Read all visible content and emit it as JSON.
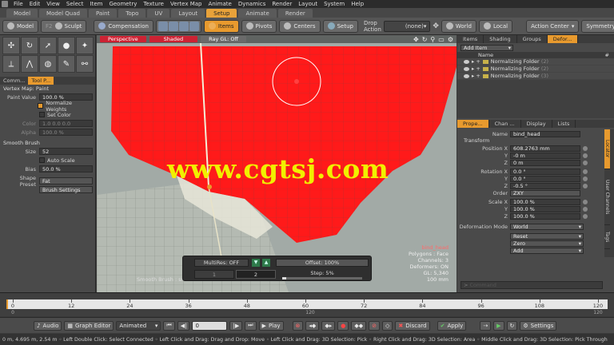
{
  "menu": [
    "File",
    "Edit",
    "View",
    "Select",
    "Item",
    "Geometry",
    "Texture",
    "Vertex Map",
    "Animate",
    "Dynamics",
    "Render",
    "Layout",
    "System",
    "Help"
  ],
  "layout_tabs": [
    "Model",
    "Model Quad",
    "Paint",
    "Topo",
    "UV",
    "Layout",
    "Setup",
    "Animate",
    "Render"
  ],
  "layout_tabs_active": "Setup",
  "toolbar": {
    "model": "Model",
    "sculpt": "Sculpt",
    "f2": "F2",
    "compensation": "Compensation",
    "items": "Items",
    "pivots": "Pivots",
    "centers": "Centers",
    "setup": "Setup",
    "drop_action_label": "Drop Action",
    "drop_action_value": "(none)",
    "world": "World",
    "local": "Local",
    "action_center": "Action Center",
    "symmetry": "Symmetry: Off"
  },
  "left_panel": {
    "tabs": [
      "Comm...",
      "Tool P..."
    ],
    "vertex_map": "Vertex Map: Paint",
    "paint_value_label": "Paint Value",
    "paint_value": "100.0 %",
    "normalize_weights": "Normalize Weights",
    "set_color": "Set Color",
    "color_label": "Color",
    "color_value": "1.0    0.0    0.0",
    "alpha_label": "Alpha",
    "alpha_value": "100.0 %",
    "smooth_brush": "Smooth Brush",
    "size_label": "Size",
    "size_value": "52",
    "auto_scale": "Auto Scale",
    "bias_label": "Bias",
    "bias_value": "50.0 %",
    "shape_preset_label": "Shape Preset",
    "shape_preset_value": "Fat",
    "brush_settings": "Brush Settings"
  },
  "viewport": {
    "view": "Perspective",
    "shading": "Shaded",
    "raygl": "Ray GL: Off",
    "watermark": "www.cgtsj.com",
    "info_title": "bind_head",
    "info_lines": [
      "Polygons : Face",
      "Channels: 3",
      "Deformers: ON",
      "GL: 5,340",
      "100 mm"
    ],
    "multires": "MultiRes: OFF",
    "offset": "Offset: 100%",
    "step": "Step:  5%",
    "level1": "1",
    "level2": "2",
    "smooth_brush_label": "Smooth Brush : sm..."
  },
  "right_panel": {
    "top_tabs": [
      "Items",
      "Shading",
      "Groups",
      "Defor..."
    ],
    "add_item": "Add Item",
    "name_col": "Name",
    "folders": [
      "Normalizing Folder",
      "Normalizing Folder",
      "Normalizing Folder"
    ],
    "folder_counts": [
      "(2)",
      "(2)",
      "(3)"
    ],
    "prop_tabs": [
      "Prope...",
      "Chan ...",
      "Display",
      "Lists"
    ],
    "name_label": "Name",
    "name_value": "bind_head",
    "transform": "Transform",
    "position_x_label": "Position X",
    "position_x": "608.2763 mm",
    "position_y": "-0 m",
    "position_z": "0 m",
    "rotation_x_label": "Rotation X",
    "rotation_x": "0.0 °",
    "rotation_y": "0.0 °",
    "rotation_z": "-0.5 °",
    "order_label": "Order",
    "order_value": "ZXY",
    "scale_x_label": "Scale X",
    "scale_x": "100.0 %",
    "scale_y": "100.0 %",
    "scale_z": "100.0 %",
    "y_label": "Y",
    "z_label": "Z",
    "deformation_mode_label": "Deformation Mode",
    "deformation_mode_value": "World",
    "reset": "Reset",
    "zero": "Zero",
    "add": "Add",
    "command_placeholder": "Command",
    "side_tabs": [
      "Locator",
      "User Channels",
      "Tags"
    ]
  },
  "timeline": {
    "ticks": [
      "0",
      "12",
      "24",
      "36",
      "48",
      "60",
      "72",
      "84",
      "96",
      "108",
      "120"
    ],
    "ticks2": [
      "0",
      "120",
      "120"
    ]
  },
  "transport": {
    "audio": "Audio",
    "graph_editor": "Graph Editor",
    "animated": "Animated",
    "frame": "0",
    "play": "Play",
    "discard": "Discard",
    "apply": "Apply",
    "settings": "Settings"
  },
  "status": "0 m, 4.695 m, 2.54 m   ◦ Left Double Click: Select Connected  ◦ Left Click and Drag: Drag and Drop: Move  ◦ Left Click and Drag: 3D Selection: Pick  ◦ Right Click and Drag: 3D Selection: Area  ◦ Middle Click and Drag: 3D Selection: Pick Through",
  "colors": {
    "accent": "#e89a2e",
    "paint_red": "#ff1a1a",
    "watermark": "#f1f000"
  }
}
